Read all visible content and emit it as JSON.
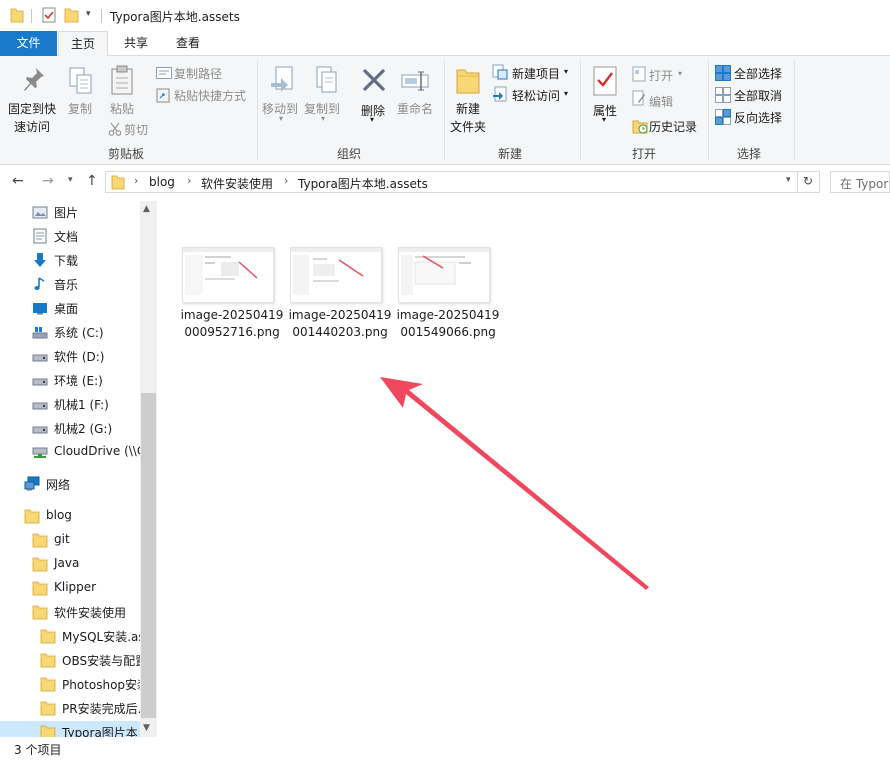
{
  "window": {
    "title": "Typora图片本地.assets"
  },
  "tabs": [
    {
      "label": "文件"
    },
    {
      "label": "主页"
    },
    {
      "label": "共享"
    },
    {
      "label": "查看"
    }
  ],
  "ribbon": {
    "clipboard": {
      "pin_line1": "固定到快",
      "pin_line2": "速访问",
      "copy": "复制",
      "paste": "粘贴",
      "copy_path": "复制路径",
      "paste_shortcut": "粘贴快捷方式",
      "cut": "剪切",
      "group": "剪贴板"
    },
    "organize": {
      "move_to": "移动到",
      "copy_to": "复制到",
      "delete": "删除",
      "rename": "重命名",
      "group": "组织"
    },
    "new": {
      "new_folder_line1": "新建",
      "new_folder_line2": "文件夹",
      "new_item": "新建项目",
      "easy_access": "轻松访问",
      "group": "新建"
    },
    "open": {
      "properties": "属性",
      "open": "打开",
      "edit": "编辑",
      "history": "历史记录",
      "group": "打开"
    },
    "select": {
      "select_all": "全部选择",
      "select_none": "全部取消",
      "invert": "反向选择",
      "group": "选择"
    }
  },
  "address": {
    "crumbs": [
      "blog",
      "软件安装使用",
      "Typora图片本地.assets"
    ],
    "search_placeholder": "在 Typor"
  },
  "nav": {
    "items": [
      {
        "label": "图片"
      },
      {
        "label": "文档"
      },
      {
        "label": "下载"
      },
      {
        "label": "音乐"
      },
      {
        "label": "桌面"
      },
      {
        "label": "系统 (C:)"
      },
      {
        "label": "软件 (D:)"
      },
      {
        "label": "环境 (E:)"
      },
      {
        "label": "机械1 (F:)"
      },
      {
        "label": "机械2 (G:)"
      },
      {
        "label": "CloudDrive (\\\\C"
      },
      {
        "label": "网络"
      },
      {
        "label": "blog"
      },
      {
        "label": "git"
      },
      {
        "label": "Java"
      },
      {
        "label": "Klipper"
      },
      {
        "label": "软件安装使用"
      },
      {
        "label": "MySQL安装.as"
      },
      {
        "label": "OBS安装与配置"
      },
      {
        "label": "Photoshop安装"
      },
      {
        "label": "PR安装完成后."
      },
      {
        "label": "Typora图片本"
      }
    ]
  },
  "files": [
    {
      "name": "image-20250419000952716.png"
    },
    {
      "name": "image-20250419001440203.png"
    },
    {
      "name": "image-20250419001549066.png"
    }
  ],
  "status": {
    "count": "3 个项目"
  },
  "colors": {
    "accent": "#1979ca",
    "arrow": "#f0485e",
    "folder": "#f8d775",
    "selection": "#cce8ff"
  }
}
